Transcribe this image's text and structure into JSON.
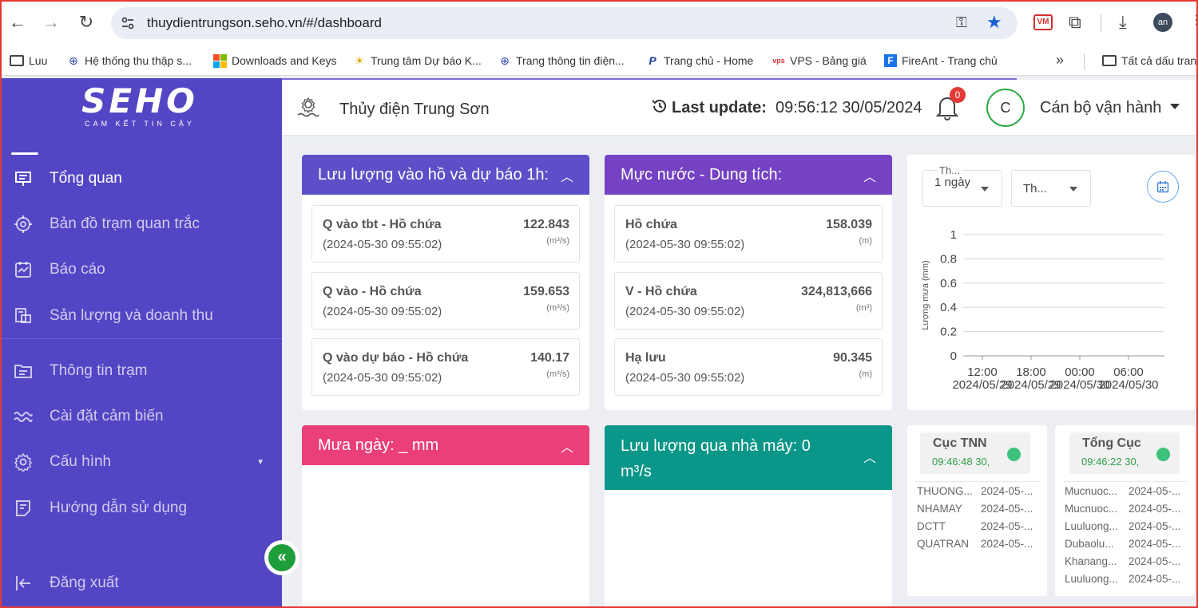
{
  "browser": {
    "url": "thuydientrungson.seho.vn/#/dashboard",
    "vm_label": "VM",
    "profile_initials": "an",
    "bookmarks": [
      {
        "label": "Luu"
      },
      {
        "label": "Hệ thống thu thập s..."
      },
      {
        "label": "Downloads and Keys"
      },
      {
        "label": "Trung tâm Dự báo K..."
      },
      {
        "label": "Trang thông tin điện..."
      },
      {
        "label": "Trang chủ - Home"
      },
      {
        "label": "VPS - Bảng giá"
      },
      {
        "label": "FireAnt - Trang chủ"
      },
      {
        "label": "Tất cả dấu trang"
      }
    ]
  },
  "sidebar": {
    "logo": "SEHO",
    "tagline": "CAM KẾT TIN CẬY",
    "items": [
      {
        "label": "Tổng quan"
      },
      {
        "label": "Bản đồ trạm quan trắc"
      },
      {
        "label": "Báo cáo"
      },
      {
        "label": "Sản lượng và doanh thu"
      },
      {
        "label": "Thông tin trạm"
      },
      {
        "label": "Cài đặt cảm biến"
      },
      {
        "label": "Cấu hình"
      },
      {
        "label": "Hướng dẫn sử dụng"
      },
      {
        "label": "Đăng xuất"
      }
    ],
    "collapse_icon": "«"
  },
  "header": {
    "station": "Thủy điện Trung Sơn",
    "last_update_label": "Last update:",
    "last_update_value": "09:56:12 30/05/2024",
    "notification_count": "0",
    "avatar_letter": "C",
    "role": "Cán bộ vận hành"
  },
  "inflow": {
    "title": "Lưu lượng vào hồ và dự báo 1h:",
    "metrics": [
      {
        "name": "Q vào tbt - Hồ chứa",
        "time": "(2024-05-30 09:55:02)",
        "value": "122.843",
        "unit": "(m³/s)"
      },
      {
        "name": "Q vào - Hồ chứa",
        "time": "(2024-05-30 09:55:02)",
        "value": "159.653",
        "unit": "(m³/s)"
      },
      {
        "name": "Q vào dự báo - Hồ chứa",
        "time": "(2024-05-30 09:55:02)",
        "value": "140.17",
        "unit": "(m³/s)"
      }
    ]
  },
  "level": {
    "title": "Mực nước - Dung tích:",
    "metrics": [
      {
        "name": "Hồ chứa",
        "time": "(2024-05-30 09:55:02)",
        "value": "158.039",
        "unit": "(m)"
      },
      {
        "name": "V - Hồ chứa",
        "time": "(2024-05-30 09:55:02)",
        "value": "324,813,666",
        "unit": "(m³)"
      },
      {
        "name": "Hạ lưu",
        "time": "(2024-05-30 09:55:02)",
        "value": "90.345",
        "unit": "(m)"
      }
    ]
  },
  "rain_chart": {
    "select1_small": "Th...",
    "select1_value": "1 ngày",
    "select2_value": "Th..."
  },
  "chart_data": {
    "type": "line",
    "title": "",
    "ylabel": "Lượng mưa (mm)",
    "xlabel": "",
    "ylim": [
      0,
      1
    ],
    "yticks": [
      "1",
      "0.8",
      "0.6",
      "0.4",
      "0.2",
      "0"
    ],
    "x_ticks": [
      {
        "time": "12:00",
        "date": "2024/05/29"
      },
      {
        "time": "18:00",
        "date": "2024/05/29"
      },
      {
        "time": "00:00",
        "date": "2024/05/30"
      },
      {
        "time": "06:00",
        "date": "2024/05/30"
      }
    ],
    "series": [],
    "grid": true
  },
  "rain_day": {
    "title": "Mưa ngày: _ mm"
  },
  "plant_flow": {
    "title_line1": "Lưu lượng qua nhà máy: 0",
    "title_line2": "m³/s"
  },
  "station_cuc": {
    "title": "Cục TNN",
    "time": "09:46:48 30,",
    "rows": [
      {
        "name": "THUONG...",
        "date": "2024-05-..."
      },
      {
        "name": "NHAMAY",
        "date": "2024-05-..."
      },
      {
        "name": "DCTT",
        "date": "2024-05-..."
      },
      {
        "name": "QUATRAN",
        "date": "2024-05-..."
      }
    ]
  },
  "station_tong": {
    "title": "Tổng Cục",
    "time": "09:46:22 30,",
    "rows": [
      {
        "name": "Mucnuoc...",
        "date": "2024-05-..."
      },
      {
        "name": "Mucnuoc...",
        "date": "2024-05-..."
      },
      {
        "name": "Luuluong...",
        "date": "2024-05-..."
      },
      {
        "name": "Dubaolu...",
        "date": "2024-05-..."
      },
      {
        "name": "Khanang...",
        "date": "2024-05-..."
      },
      {
        "name": "Luuluong...",
        "date": "2024-05-..."
      }
    ]
  },
  "colors": {
    "sidebar": "#5346c4",
    "card_inflow": "#5c4fc7",
    "card_level": "#7442c2",
    "card_rain": "#ea3f77",
    "card_plant": "#0a9688",
    "status_ok": "#3cc27a"
  }
}
